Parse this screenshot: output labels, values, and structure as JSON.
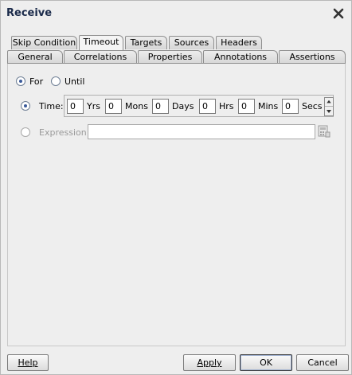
{
  "dialog": {
    "title": "Receive"
  },
  "tabs_row1": [
    "Skip Condition",
    "Timeout",
    "Targets",
    "Sources",
    "Headers"
  ],
  "tabs_row2": [
    "General",
    "Correlations",
    "Properties",
    "Annotations",
    "Assertions"
  ],
  "active_tab": "Timeout",
  "timeout": {
    "for_label": "For",
    "until_label": "Until",
    "mode": "For",
    "time_label": "Time:",
    "time_selected": true,
    "years": "0",
    "years_label": "Yrs",
    "months": "0",
    "months_label": "Mons",
    "days": "0",
    "days_label": "Days",
    "hours": "0",
    "hours_label": "Hrs",
    "minutes": "0",
    "minutes_label": "Mins",
    "seconds": "0",
    "seconds_label": "Secs",
    "expression_label": "Expression:",
    "expression_value": "",
    "expression_enabled": false
  },
  "buttons": {
    "help": "Help",
    "apply": "Apply",
    "ok": "OK",
    "cancel": "Cancel"
  },
  "icons": {
    "close": "close-icon",
    "expression_builder": "expression-builder-icon",
    "spinner": "spinner-arrows-icon"
  }
}
